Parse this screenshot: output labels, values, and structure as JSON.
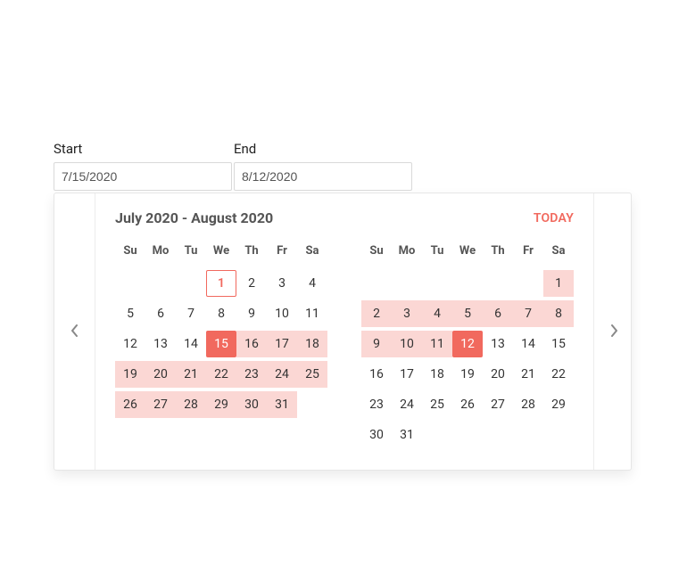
{
  "accentColor": "#F1695E",
  "fields": {
    "start": {
      "label": "Start",
      "value": "7/15/2020"
    },
    "end": {
      "label": "End",
      "value": "8/12/2020"
    }
  },
  "header": {
    "title": "July 2020 - August 2020",
    "todayLabel": "TODAY"
  },
  "dayHeaders": [
    "Su",
    "Mo",
    "Tu",
    "We",
    "Th",
    "Fr",
    "Sa"
  ],
  "months": {
    "left": {
      "leadingBlanks": 3,
      "days": 31,
      "today": 1,
      "selected": 15,
      "rangeStart": 15,
      "rangeEnd": 31
    },
    "right": {
      "leadingBlanks": 6,
      "days": 31,
      "today": 1,
      "selected": 12,
      "rangeStart": 1,
      "rangeEnd": 12
    }
  }
}
